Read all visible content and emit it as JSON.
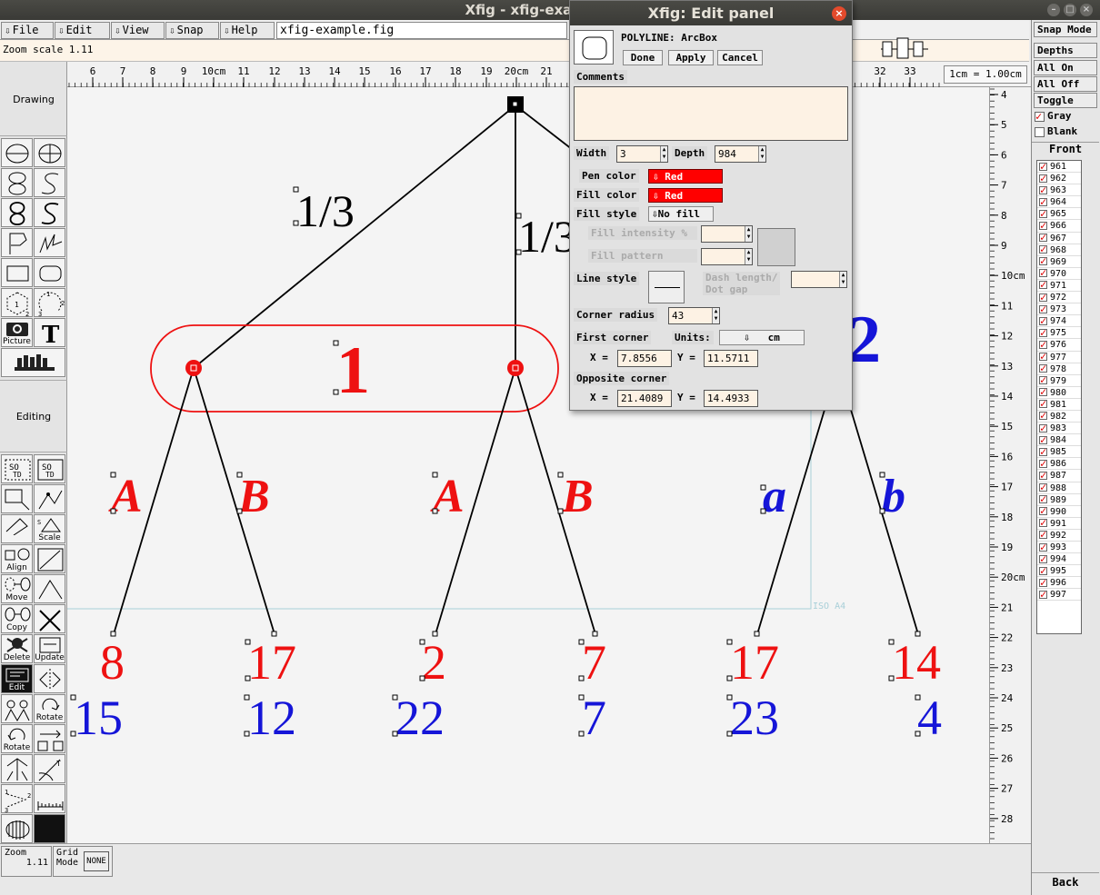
{
  "window": {
    "title": "Xfig - xfig-example.fig"
  },
  "menu": {
    "items": [
      "File",
      "Edit",
      "View",
      "Snap",
      "Help"
    ],
    "filename": "xfig-example.fig"
  },
  "message": {
    "text": "Zoom scale  1.11"
  },
  "ruler": {
    "top_ticks": [
      "6",
      "7",
      "8",
      "9",
      "10cm",
      "11",
      "12",
      "13",
      "14",
      "15",
      "16",
      "17",
      "18",
      "19",
      "20cm",
      "21",
      "32",
      "33"
    ],
    "unit_label": "1cm = 1.00cm",
    "right_ticks": [
      "4",
      "5",
      "6",
      "7",
      "8",
      "9",
      "10cm",
      "11",
      "12",
      "13",
      "14",
      "15",
      "16",
      "17",
      "18",
      "19",
      "20cm",
      "21",
      "22",
      "23",
      "24",
      "25",
      "26",
      "27",
      "28"
    ]
  },
  "sidebar": {
    "drawing_label": "Drawing",
    "editing_label": "Editing",
    "tool_labels": {
      "picture": "Picture",
      "scale": "Scale",
      "align": "Align",
      "move": "Move",
      "copy": "Copy",
      "delete": "Delete",
      "update": "Update",
      "edit": "Edit",
      "rotate": "Rotate"
    }
  },
  "bottom": {
    "zoom_label": "Zoom",
    "zoom_value": "1.11",
    "grid_label": "Grid",
    "grid_mode_label": "Mode",
    "grid_value": "NONE"
  },
  "right_panel": {
    "snap_mode": "Snap Mode",
    "depths_label": "Depths",
    "all_on": "All On",
    "all_off": "All Off",
    "toggle": "Toggle",
    "gray": "Gray",
    "blank": "Blank",
    "front": "Front",
    "back": "Back",
    "depths": [
      "961",
      "962",
      "963",
      "964",
      "965",
      "966",
      "967",
      "968",
      "969",
      "970",
      "971",
      "972",
      "973",
      "974",
      "975",
      "976",
      "977",
      "978",
      "979",
      "980",
      "981",
      "982",
      "983",
      "984",
      "985",
      "986",
      "987",
      "988",
      "989",
      "990",
      "991",
      "992",
      "993",
      "994",
      "995",
      "996",
      "997"
    ]
  },
  "edit_panel": {
    "title": "Xfig: Edit panel",
    "object_type": "POLYLINE: ArcBox",
    "done": "Done",
    "apply": "Apply",
    "cancel": "Cancel",
    "comments_label": "Comments",
    "comments_value": "",
    "width_label": "Width",
    "width_value": "3",
    "depth_label": "Depth",
    "depth_value": "984",
    "pen_color_label": "Pen color",
    "pen_color_value": "Red",
    "fill_color_label": "Fill color",
    "fill_color_value": "Red",
    "fill_style_label": "Fill style",
    "fill_style_value": "No fill",
    "fill_intensity_label": "Fill intensity %",
    "fill_pattern_label": "Fill pattern",
    "line_style_label": "Line style",
    "dash_label_1": "Dash length/",
    "dash_label_2": "Dot gap",
    "corner_radius_label": "Corner radius",
    "corner_radius_value": "43",
    "first_corner_label": "First corner",
    "units_label": "Units:",
    "units_value": "cm",
    "fc_x_label": "X =",
    "fc_x_value": "7.8556",
    "fc_y_label": "Y =",
    "fc_y_value": "11.5711",
    "opposite_corner_label": "Opposite corner",
    "oc_x_label": "X =",
    "oc_x_value": "21.4089",
    "oc_y_label": "Y =",
    "oc_y_value": "14.4933"
  },
  "figure": {
    "branch_labels": [
      "1/3",
      "1/3"
    ],
    "node_1": "1",
    "node_2": "2",
    "moves": [
      "A",
      "B",
      "A",
      "B",
      "a",
      "b"
    ],
    "payoffs_p1": [
      "8",
      "17",
      "2",
      "7",
      "17",
      "14"
    ],
    "payoffs_p2": [
      "15",
      "12",
      "22",
      "7",
      "23",
      "4"
    ],
    "paper_label": "ISO A4"
  },
  "colors": {
    "red": "#ee1111",
    "blue": "#1515d8",
    "titlebar": "#3c3b37"
  }
}
